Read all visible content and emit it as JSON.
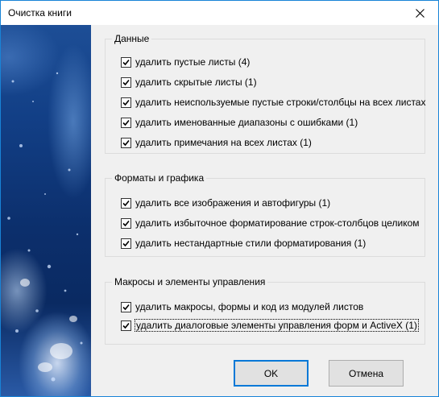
{
  "window": {
    "title": "Очистка книги"
  },
  "groups": [
    {
      "title": "Данные",
      "items": [
        {
          "label": "удалить пустые листы (4)",
          "checked": true
        },
        {
          "label": "удалить скрытые листы (1)",
          "checked": true
        },
        {
          "label": "удалить неиспользуемые пустые строки/столбцы на всех листах",
          "checked": true
        },
        {
          "label": "удалить именованные диапазоны с ошибками (1)",
          "checked": true
        },
        {
          "label": "удалить примечания на всех листах (1)",
          "checked": true
        }
      ]
    },
    {
      "title": "Форматы и графика",
      "items": [
        {
          "label": "удалить все изображения и автофигуры (1)",
          "checked": true
        },
        {
          "label": "удалить избыточное форматирование строк-столбцов целиком",
          "checked": true
        },
        {
          "label": "удалить нестандартные стили форматирования (1)",
          "checked": true
        }
      ]
    },
    {
      "title": "Макросы и элементы управления",
      "items": [
        {
          "label": "удалить макросы, формы и код из модулей листов",
          "checked": true
        },
        {
          "label": "удалить диалоговые элементы управления форм и ActiveX (1)",
          "checked": true
        }
      ]
    }
  ],
  "buttons": {
    "ok": "OK",
    "cancel": "Отмена"
  },
  "colors": {
    "window_border": "#1883d7",
    "default_button_border": "#0078d7",
    "dialog_bg": "#f0f0f0"
  },
  "icons": {
    "close": "close-icon",
    "check": "checkmark-icon"
  }
}
